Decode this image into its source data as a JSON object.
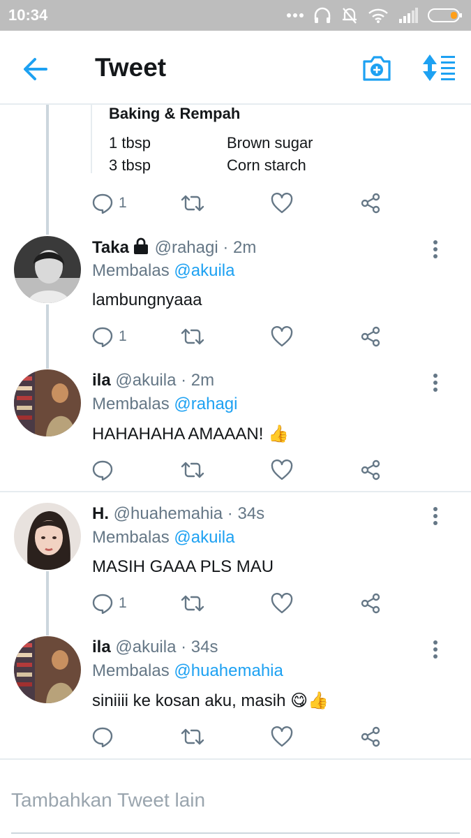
{
  "status_bar": {
    "time": "10:34",
    "battery_color": "#ff9f1a"
  },
  "header": {
    "title": "Tweet",
    "back_icon": "arrow-left-icon",
    "camera_icon": "camera-add-icon",
    "sort_icon": "sort-icon"
  },
  "colors": {
    "accent": "#1da1f2",
    "muted": "#657786",
    "line": "#e6ecf0"
  },
  "recipe": {
    "heading": "Baking & Rempah",
    "rows": [
      {
        "qty": "1 tbsp",
        "item": "Brown sugar"
      },
      {
        "qty": "3 tbsp",
        "item": "Corn starch"
      }
    ],
    "reply_count": "1"
  },
  "tweets": [
    {
      "name": "Taka",
      "handle": "@rahagi · 2m",
      "reply_prefix": "Membalas",
      "reply_to": "@akuila",
      "text": "lambungnyaaa",
      "reply_count": "1",
      "locked": true
    },
    {
      "name": "ila",
      "handle": "@akuila · 2m",
      "reply_prefix": "Membalas",
      "reply_to": "@rahagi",
      "text": "HAHAHAHA AMAAAN! 👍",
      "reply_count": ""
    },
    {
      "name": "H.",
      "handle": "@huahemahia · 34s",
      "reply_prefix": "Membalas",
      "reply_to": "@akuila",
      "text": "MASIH GAAA PLS MAU",
      "reply_count": "1"
    },
    {
      "name": "ila",
      "handle": "@akuila · 34s",
      "reply_prefix": "Membalas",
      "reply_to": "@huahemahia",
      "text": "siniiii ke kosan aku, masih 😋👍",
      "reply_count": ""
    }
  ],
  "compose": {
    "placeholder": "Tambahkan Tweet lain"
  }
}
